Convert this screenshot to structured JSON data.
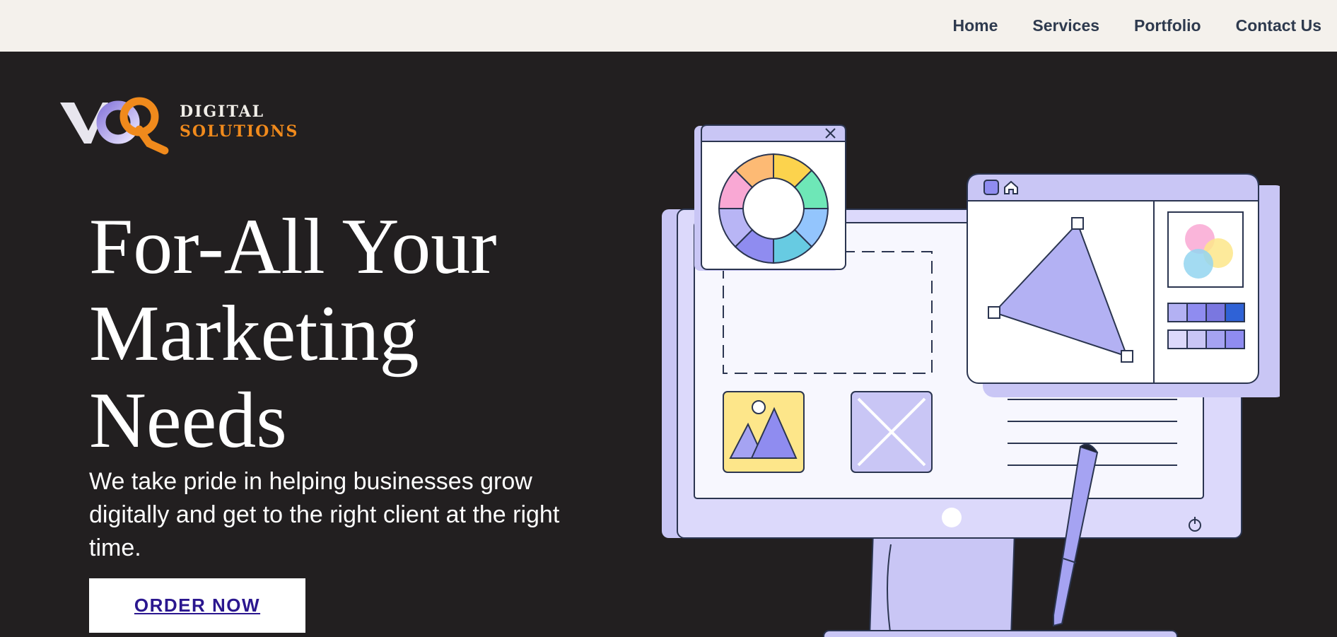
{
  "nav": {
    "items": [
      {
        "label": "Home"
      },
      {
        "label": "Services"
      },
      {
        "label": "Portfolio"
      },
      {
        "label": "Contact Us"
      }
    ]
  },
  "brand": {
    "line1": "DIGITAL",
    "line2": "SOLUTIONS",
    "accent_color": "#f08a1c",
    "logo_letters": "VOQ"
  },
  "hero": {
    "title": "For-All Your Marketing Needs",
    "subtitle": "We take pride in helping businesses grow digitally and get to the right client at the right time.",
    "cta_label": "ORDER NOW"
  },
  "colors": {
    "background": "#221f20",
    "topbar": "#f4f1ec",
    "nav_text": "#2e3a4e",
    "cta_text": "#2b178f",
    "illustration_purple": "#c9c6f5"
  },
  "illustration": {
    "icons": [
      "monitor-icon",
      "color-wheel-icon",
      "close-icon",
      "home-icon",
      "triangle-vector-icon",
      "image-icon",
      "pen-icon",
      "power-icon"
    ]
  }
}
